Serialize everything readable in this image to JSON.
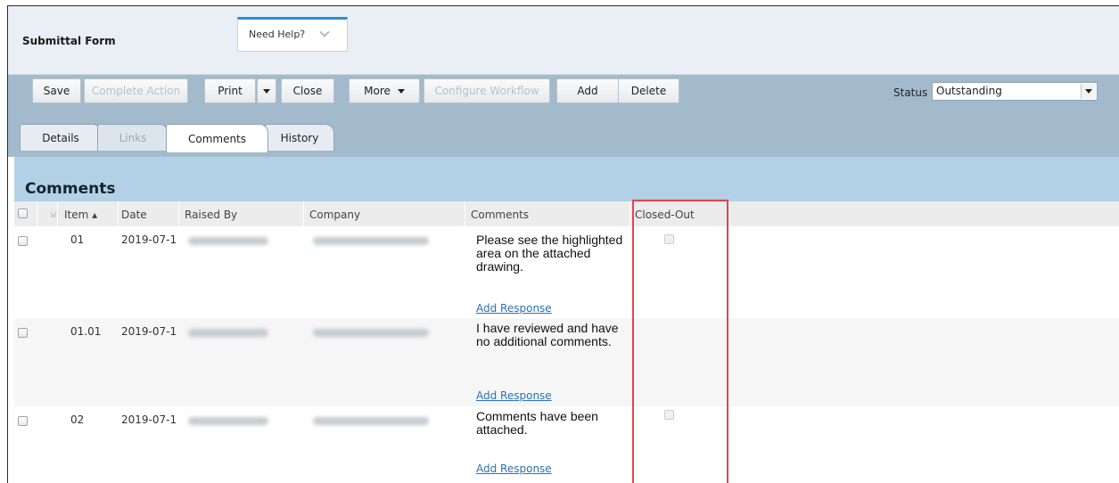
{
  "header": {
    "form_title": "Submittal Form",
    "help_label": "Need Help?"
  },
  "toolbar": {
    "save": "Save",
    "complete_action": "Complete Action",
    "print": "Print",
    "close": "Close",
    "more": "More",
    "configure_workflow": "Configure Workflow",
    "add": "Add",
    "delete": "Delete",
    "status_label": "Status",
    "status_value": "Outstanding"
  },
  "tabs": [
    {
      "label": "Details"
    },
    {
      "label": "Links"
    },
    {
      "label": "Comments"
    },
    {
      "label": "History"
    }
  ],
  "section": {
    "title": "Comments"
  },
  "table": {
    "columns": {
      "item": "Item ▴",
      "date": "Date",
      "raised_by": "Raised By",
      "company": "Company",
      "comments": "Comments",
      "closed_out": "Closed-Out"
    },
    "rows": [
      {
        "item": "01",
        "date": "2019-07-1",
        "comment": "Please see the highlighted area on the attached drawing.",
        "action": "Add Response"
      },
      {
        "item": "01.01",
        "date": "2019-07-1",
        "comment": "I have reviewed and have no additional comments.",
        "action": "Add Response"
      },
      {
        "item": "02",
        "date": "2019-07-1",
        "comment": "Comments have been attached.",
        "action": "Add Response"
      }
    ]
  },
  "colors": {
    "toolbar_band": "#a3bacc",
    "section_bar": "#b3d1e6",
    "link": "#2a73b5",
    "highlight": "#e8424e"
  }
}
